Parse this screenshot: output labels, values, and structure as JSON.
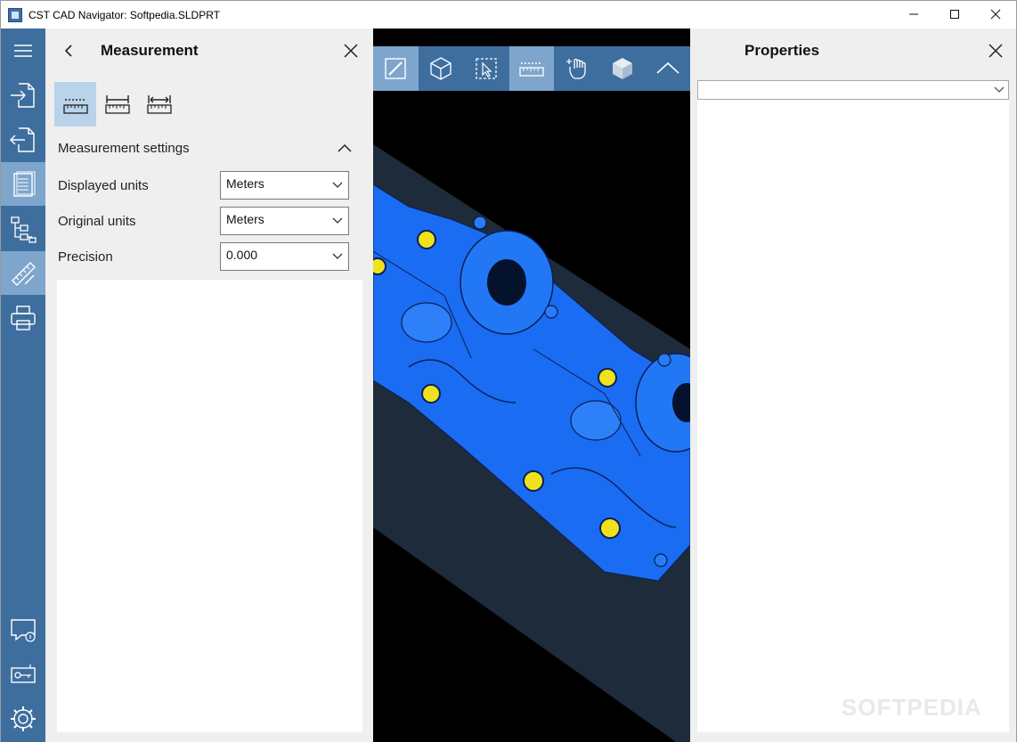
{
  "window": {
    "title": "CST CAD Navigator: Softpedia.SLDPRT",
    "controls": [
      "—",
      "☐",
      "✕"
    ]
  },
  "rail": {
    "items": [
      {
        "icon": "hamburger-menu-icon",
        "active": false
      },
      {
        "icon": "import-file-icon",
        "active": false
      },
      {
        "icon": "export-file-icon",
        "active": false
      },
      {
        "icon": "document-icon",
        "active": true
      },
      {
        "icon": "tree-structure-icon",
        "active": false
      },
      {
        "icon": "measurement-tools-icon",
        "active": true
      },
      {
        "icon": "printer-icon",
        "active": false
      },
      {
        "icon": "feedback-icon",
        "active": false
      },
      {
        "icon": "license-key-icon",
        "active": false
      },
      {
        "icon": "settings-gear-icon",
        "active": false
      }
    ]
  },
  "measurement": {
    "title": "Measurement",
    "modes": [
      {
        "icon": "point-distance-icon",
        "active": true
      },
      {
        "icon": "edge-distance-icon",
        "active": false
      },
      {
        "icon": "dimension-arrows-icon",
        "active": false
      }
    ],
    "settings_header": "Measurement settings",
    "fields": [
      {
        "label": "Displayed units",
        "value": "Meters"
      },
      {
        "label": "Original units",
        "value": "Meters"
      },
      {
        "label": "Precision",
        "value": "0.000"
      }
    ]
  },
  "viewport": {
    "toolbar": [
      {
        "icon": "view-mode-icon",
        "active": true
      },
      {
        "icon": "wireframe-cube-icon",
        "active": false
      },
      {
        "icon": "select-cursor-icon",
        "active": false
      },
      {
        "icon": "ruler-icon",
        "active": true
      },
      {
        "icon": "pan-hand-icon",
        "active": false
      },
      {
        "icon": "solid-cube-icon",
        "active": false
      },
      {
        "icon": "collapse-toolbar-icon",
        "active": false
      }
    ],
    "colors": {
      "background": "#000000",
      "part": "#1a6cf2",
      "plate": "#1f2c3d",
      "holes": "#f0e21a"
    }
  },
  "properties": {
    "title": "Properties",
    "selected": ""
  },
  "watermark": "SOFTPEDIA"
}
